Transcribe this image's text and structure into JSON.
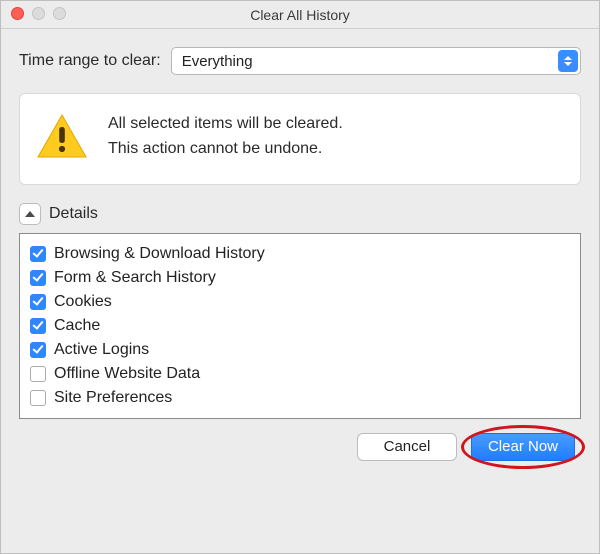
{
  "window": {
    "title": "Clear All History"
  },
  "range": {
    "label": "Time range to clear:",
    "selected": "Everything"
  },
  "warning": {
    "line1": "All selected items will be cleared.",
    "line2": "This action cannot be undone."
  },
  "details": {
    "label": "Details",
    "items": [
      {
        "label": "Browsing & Download History",
        "checked": true
      },
      {
        "label": "Form & Search History",
        "checked": true
      },
      {
        "label": "Cookies",
        "checked": true
      },
      {
        "label": "Cache",
        "checked": true
      },
      {
        "label": "Active Logins",
        "checked": true
      },
      {
        "label": "Offline Website Data",
        "checked": false
      },
      {
        "label": "Site Preferences",
        "checked": false
      }
    ]
  },
  "buttons": {
    "cancel": "Cancel",
    "clear": "Clear Now"
  }
}
